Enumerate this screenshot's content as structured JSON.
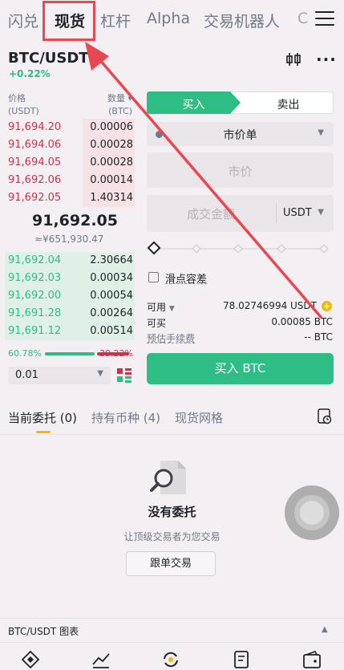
{
  "top_tabs": [
    "闪兑",
    "现货",
    "杠杆",
    "Alpha",
    "交易机器人",
    "C"
  ],
  "pair": {
    "symbol": "BTC/USDT",
    "change": "+0.22%"
  },
  "orderbook": {
    "price_label": "价格",
    "price_unit": "(USDT)",
    "qty_label": "数量",
    "qty_unit": "(BTC)",
    "asks": [
      {
        "price": "91,694.20",
        "qty": "0.00006",
        "depth": 0.4
      },
      {
        "price": "91,694.06",
        "qty": "0.00028",
        "depth": 0.4
      },
      {
        "price": "91,694.05",
        "qty": "0.00028",
        "depth": 0.4
      },
      {
        "price": "91,692.06",
        "qty": "0.00014",
        "depth": 0.4
      },
      {
        "price": "91,692.05",
        "qty": "1.40314",
        "depth": 0.4
      }
    ],
    "last_price": "91,692.05",
    "last_price_cny": "≈¥651,930.47",
    "bids": [
      {
        "price": "91,692.04",
        "qty": "2.30664",
        "depth": 1.0
      },
      {
        "price": "91,692.03",
        "qty": "0.00034",
        "depth": 1.0
      },
      {
        "price": "91,692.00",
        "qty": "0.00054",
        "depth": 1.0
      },
      {
        "price": "91,691.28",
        "qty": "0.00264",
        "depth": 1.0
      },
      {
        "price": "91,691.12",
        "qty": "0.00514",
        "depth": 1.0
      }
    ],
    "buy_ratio": "60.78%",
    "sell_ratio": "39.22%",
    "buy_ratio_value": 0.6078,
    "precision": "0.01"
  },
  "order_form": {
    "buy_tab": "买入",
    "sell_tab": "卖出",
    "order_type": "市价单",
    "price_placeholder": "市价",
    "amount_placeholder": "成交金额",
    "amount_unit": "USDT",
    "slippage_label": "滑点容差",
    "available_label": "可用",
    "available_value": "78.02746994 USDT",
    "sellable_label": "可买",
    "sellable_value": "0.00085 BTC",
    "fee_label": "预估手续费",
    "fee_value": "-- BTC",
    "submit_label": "买入 BTC"
  },
  "bottom_tabs": {
    "open_orders": "当前委托 (0)",
    "holdings": "持有币种 (4)",
    "grid": "现货网格"
  },
  "empty_state": {
    "title": "没有委托",
    "subtitle": "让顶级交易者为您交易",
    "button": "跟单交易"
  },
  "chart_bar": {
    "label": "BTC/USDT 图表"
  },
  "colors": {
    "green": "#2ebd85",
    "red": "#cf304a",
    "highlight": "#e8484f"
  }
}
